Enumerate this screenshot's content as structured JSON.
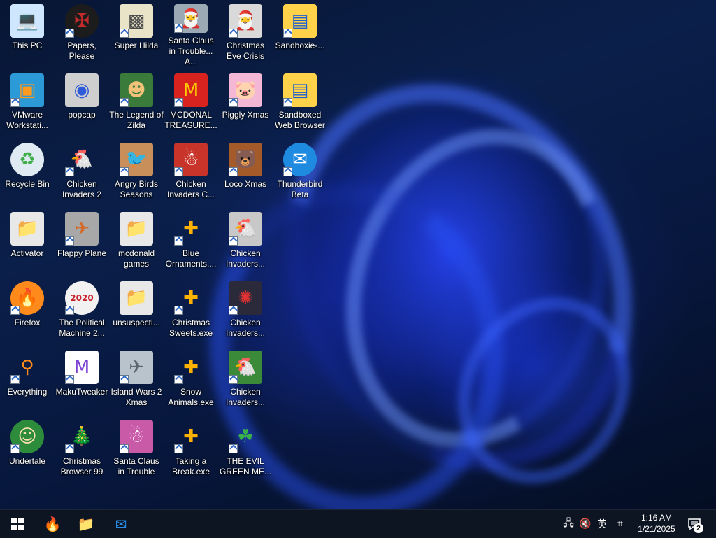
{
  "desktop": {
    "icons": [
      {
        "id": "this-pc",
        "label": "This PC",
        "col": 0,
        "row": 0,
        "shortcut": false,
        "glyph": "💻",
        "bg": "#cfe6ff",
        "fg": "#1e6fc4",
        "shape": "tile"
      },
      {
        "id": "vmware",
        "label": "VMware Workstati...",
        "col": 0,
        "row": 1,
        "shortcut": true,
        "glyph": "▣",
        "bg": "#2b9ad6",
        "fg": "#ff9a1f",
        "shape": "tile"
      },
      {
        "id": "recycle-bin",
        "label": "Recycle Bin",
        "col": 0,
        "row": 2,
        "shortcut": false,
        "glyph": "♻",
        "bg": "#dfeaf3",
        "fg": "#3fae49",
        "shape": "round"
      },
      {
        "id": "activator",
        "label": "Activator",
        "col": 0,
        "row": 3,
        "shortcut": false,
        "glyph": "📁",
        "bg": "#e8e8e8",
        "fg": "#9aa3ad",
        "shape": "tile"
      },
      {
        "id": "firefox",
        "label": "Firefox",
        "col": 0,
        "row": 4,
        "shortcut": true,
        "glyph": "🔥",
        "bg": "#ff8a1c",
        "fg": "#6b2fd8",
        "shape": "round"
      },
      {
        "id": "everything",
        "label": "Everything",
        "col": 0,
        "row": 5,
        "shortcut": true,
        "glyph": "⚲",
        "bg": "transparent",
        "fg": "#ff8b1a",
        "shape": "tile"
      },
      {
        "id": "undertale",
        "label": "Undertale",
        "col": 0,
        "row": 6,
        "shortcut": true,
        "glyph": "☺",
        "bg": "#2d8c3c",
        "fg": "#ffe1b0",
        "shape": "round"
      },
      {
        "id": "papers-please",
        "label": "Papers, Please",
        "col": 1,
        "row": 0,
        "shortcut": true,
        "glyph": "✠",
        "bg": "#1c1c1c",
        "fg": "#c22b2b",
        "shape": "round"
      },
      {
        "id": "popcap",
        "label": "popcap",
        "col": 1,
        "row": 1,
        "shortcut": false,
        "glyph": "◉",
        "bg": "#cfcfcf",
        "fg": "#2f5ad8",
        "shape": "tile"
      },
      {
        "id": "chicken-invaders-2",
        "label": "Chicken Invaders 2",
        "col": 1,
        "row": 2,
        "shortcut": true,
        "glyph": "🐔",
        "bg": "transparent",
        "fg": "#e03232",
        "shape": "tile"
      },
      {
        "id": "flappy-plane",
        "label": "Flappy Plane",
        "col": 1,
        "row": 3,
        "shortcut": true,
        "glyph": "✈",
        "bg": "#a8a8a8",
        "fg": "#d26a2a",
        "shape": "tile"
      },
      {
        "id": "political-machine",
        "label": "The Political Machine 2...",
        "col": 1,
        "row": 4,
        "shortcut": true,
        "glyph": "2020",
        "bg": "#f2f2f2",
        "fg": "#c8202a",
        "shape": "round"
      },
      {
        "id": "makutweaker",
        "label": "MakuTweaker",
        "col": 1,
        "row": 5,
        "shortcut": true,
        "glyph": "M",
        "bg": "#ffffff",
        "fg": "#7b3fd0",
        "shape": "tile"
      },
      {
        "id": "christmas-browser",
        "label": "Christmas Browser 99",
        "col": 1,
        "row": 6,
        "shortcut": true,
        "glyph": "🎄",
        "bg": "transparent",
        "fg": "#2f9a3a",
        "shape": "tile"
      },
      {
        "id": "super-hilda",
        "label": "Super Hilda",
        "col": 2,
        "row": 0,
        "shortcut": true,
        "glyph": "▩",
        "bg": "#e9e3c8",
        "fg": "#4a4a4a",
        "shape": "tile"
      },
      {
        "id": "legend-of-zilda",
        "label": "The Legend of Zilda",
        "col": 2,
        "row": 1,
        "shortcut": true,
        "glyph": "☻",
        "bg": "#3a7a3a",
        "fg": "#f3c27a",
        "shape": "tile"
      },
      {
        "id": "angry-birds",
        "label": "Angry Birds Seasons",
        "col": 2,
        "row": 2,
        "shortcut": true,
        "glyph": "🐦",
        "bg": "#c98f5a",
        "fg": "#c42a2a",
        "shape": "tile"
      },
      {
        "id": "mcdonald-games",
        "label": "mcdonald games",
        "col": 2,
        "row": 3,
        "shortcut": false,
        "glyph": "📁",
        "bg": "#e8e8e8",
        "fg": "#9aa3ad",
        "shape": "tile"
      },
      {
        "id": "unsuspecting",
        "label": "unsuspecti...",
        "col": 2,
        "row": 4,
        "shortcut": false,
        "glyph": "📁",
        "bg": "#e8e8e8",
        "fg": "#9aa3ad",
        "shape": "tile"
      },
      {
        "id": "island-wars",
        "label": "Island Wars 2 Xmas",
        "col": 2,
        "row": 5,
        "shortcut": true,
        "glyph": "✈",
        "bg": "#b9c3cc",
        "fg": "#5a6570",
        "shape": "tile"
      },
      {
        "id": "santa-in-trouble",
        "label": "Santa Claus in Trouble",
        "col": 2,
        "row": 6,
        "shortcut": true,
        "glyph": "☃",
        "bg": "#c85aa8",
        "fg": "#ffffff",
        "shape": "tile"
      },
      {
        "id": "santa-trouble-a",
        "label": "Santa Claus in Trouble... A...",
        "col": 3,
        "row": 0,
        "shortcut": true,
        "glyph": "🎅",
        "bg": "#9aa9b4",
        "fg": "#ffffff",
        "shape": "tile"
      },
      {
        "id": "mcdonal-treasure",
        "label": "MCDONAL TREASURE...",
        "col": 3,
        "row": 1,
        "shortcut": true,
        "glyph": "M",
        "bg": "#d8231e",
        "fg": "#ffcc00",
        "shape": "tile"
      },
      {
        "id": "chicken-invaders-c",
        "label": "Chicken Invaders C...",
        "col": 3,
        "row": 2,
        "shortcut": true,
        "glyph": "☃",
        "bg": "#c8342a",
        "fg": "#ffffff",
        "shape": "tile"
      },
      {
        "id": "blue-ornaments",
        "label": "Blue Ornaments....",
        "col": 3,
        "row": 3,
        "shortcut": true,
        "glyph": "✚",
        "bg": "transparent",
        "fg": "#ffb300",
        "shape": "tile"
      },
      {
        "id": "christmas-sweets",
        "label": "Christmas Sweets.exe",
        "col": 3,
        "row": 4,
        "shortcut": true,
        "glyph": "✚",
        "bg": "transparent",
        "fg": "#ffb300",
        "shape": "tile"
      },
      {
        "id": "snow-animals",
        "label": "Snow Animals.exe",
        "col": 3,
        "row": 5,
        "shortcut": true,
        "glyph": "✚",
        "bg": "transparent",
        "fg": "#ffb300",
        "shape": "tile"
      },
      {
        "id": "taking-a-break",
        "label": "Taking a Break.exe",
        "col": 3,
        "row": 6,
        "shortcut": true,
        "glyph": "✚",
        "bg": "transparent",
        "fg": "#ffb300",
        "shape": "tile"
      },
      {
        "id": "christmas-eve-crisis",
        "label": "Christmas Eve Crisis",
        "col": 4,
        "row": 0,
        "shortcut": true,
        "glyph": "🎅",
        "bg": "#d9d9d9",
        "fg": "#c8202a",
        "shape": "tile"
      },
      {
        "id": "piggly-xmas",
        "label": "Piggly Xmas",
        "col": 4,
        "row": 1,
        "shortcut": true,
        "glyph": "🐷",
        "bg": "#f4b7d6",
        "fg": "#d84a8c",
        "shape": "tile"
      },
      {
        "id": "loco-xmas",
        "label": "Loco Xmas",
        "col": 4,
        "row": 2,
        "shortcut": true,
        "glyph": "🐻",
        "bg": "#a55a2a",
        "fg": "#ffffff",
        "shape": "tile"
      },
      {
        "id": "chicken-invaders-r3",
        "label": "Chicken Invaders...",
        "col": 4,
        "row": 3,
        "shortcut": true,
        "glyph": "🐔",
        "bg": "#c8c8c8",
        "fg": "#c8202a",
        "shape": "tile"
      },
      {
        "id": "chicken-invaders-r4",
        "label": "Chicken Invaders...",
        "col": 4,
        "row": 4,
        "shortcut": true,
        "glyph": "✺",
        "bg": "#2a2a3a",
        "fg": "#e03232",
        "shape": "tile"
      },
      {
        "id": "chicken-invaders-r5",
        "label": "Chicken Invaders...",
        "col": 4,
        "row": 5,
        "shortcut": true,
        "glyph": "🐔",
        "bg": "#3a8a3a",
        "fg": "#ffd24a",
        "shape": "tile"
      },
      {
        "id": "evil-green-me",
        "label": "THE EVIL GREEN ME...",
        "col": 4,
        "row": 6,
        "shortcut": true,
        "glyph": "☘",
        "bg": "transparent",
        "fg": "#3ab04a",
        "shape": "tile"
      },
      {
        "id": "sandboxie",
        "label": "Sandboxie-...",
        "col": 5,
        "row": 0,
        "shortcut": true,
        "glyph": "▤",
        "bg": "#ffd24a",
        "fg": "#1e5fd0",
        "shape": "tile"
      },
      {
        "id": "sandboxed-browser",
        "label": "Sandboxed Web Browser",
        "col": 5,
        "row": 1,
        "shortcut": true,
        "glyph": "▤",
        "bg": "#ffd24a",
        "fg": "#1e5fd0",
        "shape": "tile"
      },
      {
        "id": "thunderbird-beta",
        "label": "Thunderbird Beta",
        "col": 5,
        "row": 2,
        "shortcut": true,
        "glyph": "✉",
        "bg": "#1f8be0",
        "fg": "#ffffff",
        "shape": "round"
      }
    ]
  },
  "taskbar": {
    "start_glyph": "⊞",
    "pinned": [
      {
        "id": "firefox",
        "glyph": "🔥",
        "color": "#ff8a1c"
      },
      {
        "id": "file-explorer",
        "glyph": "📁",
        "color": "#f5c542"
      },
      {
        "id": "thunderbird",
        "glyph": "✉",
        "color": "#2a8de8"
      }
    ],
    "tray": {
      "network_glyph": "🖧",
      "volume_glyph": "🔇",
      "ime_label": "英",
      "ime_mode_glyph": "⌗"
    },
    "clock": {
      "time": "1:16 AM",
      "date": "1/21/2025"
    },
    "notifications": {
      "count": "2"
    }
  }
}
